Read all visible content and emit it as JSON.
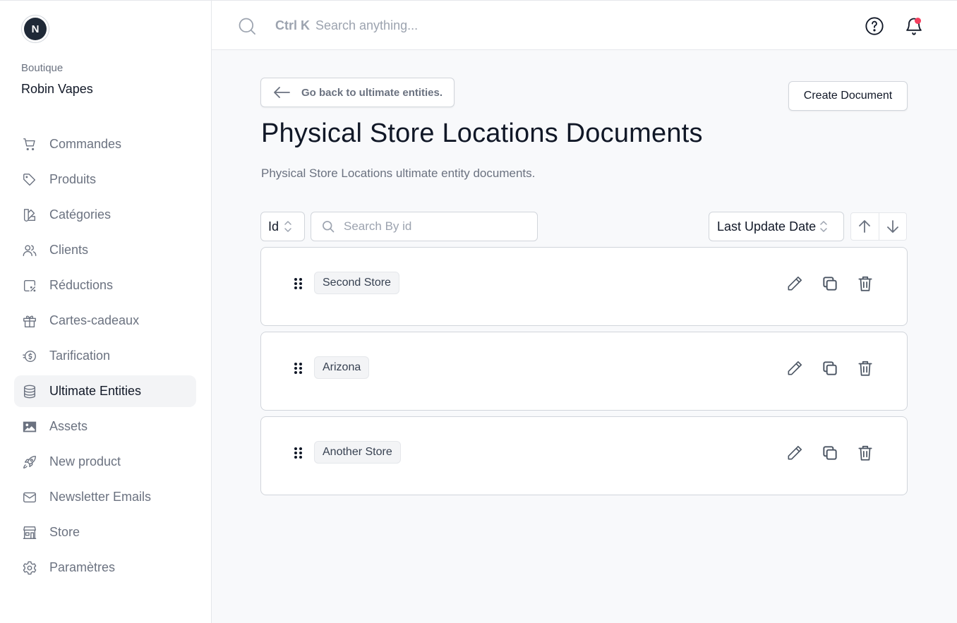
{
  "sidebar": {
    "logo_letter": "N",
    "shop_label": "Boutique",
    "shop_name": "Robin Vapes",
    "items": [
      {
        "label": "Commandes",
        "icon": "cart-icon"
      },
      {
        "label": "Produits",
        "icon": "tag-icon"
      },
      {
        "label": "Catégories",
        "icon": "swatch-icon"
      },
      {
        "label": "Clients",
        "icon": "users-icon"
      },
      {
        "label": "Réductions",
        "icon": "discount-icon"
      },
      {
        "label": "Cartes-cadeaux",
        "icon": "gift-icon"
      },
      {
        "label": "Tarification",
        "icon": "dollar-coin-icon"
      },
      {
        "label": "Ultimate Entities",
        "icon": "database-icon",
        "active": true
      },
      {
        "label": "Assets",
        "icon": "image-icon"
      },
      {
        "label": "New product",
        "icon": "rocket-icon"
      },
      {
        "label": "Newsletter Emails",
        "icon": "mail-icon"
      },
      {
        "label": "Store",
        "icon": "storefront-icon"
      },
      {
        "label": "Paramètres",
        "icon": "gear-icon"
      }
    ]
  },
  "topbar": {
    "shortcut": "Ctrl K",
    "search_placeholder": "Search anything...",
    "notification_accent": "#f43f5e"
  },
  "main": {
    "back_label": "Go back to ultimate entities.",
    "create_label": "Create Document",
    "title": "Physical Store Locations Documents",
    "description": "Physical Store Locations ultimate entity documents.",
    "filter_field": "Id",
    "filter_placeholder": "Search By id",
    "sort_field": "Last Update Date",
    "documents": [
      {
        "name": "Second Store"
      },
      {
        "name": "Arizona"
      },
      {
        "name": "Another Store"
      }
    ]
  }
}
